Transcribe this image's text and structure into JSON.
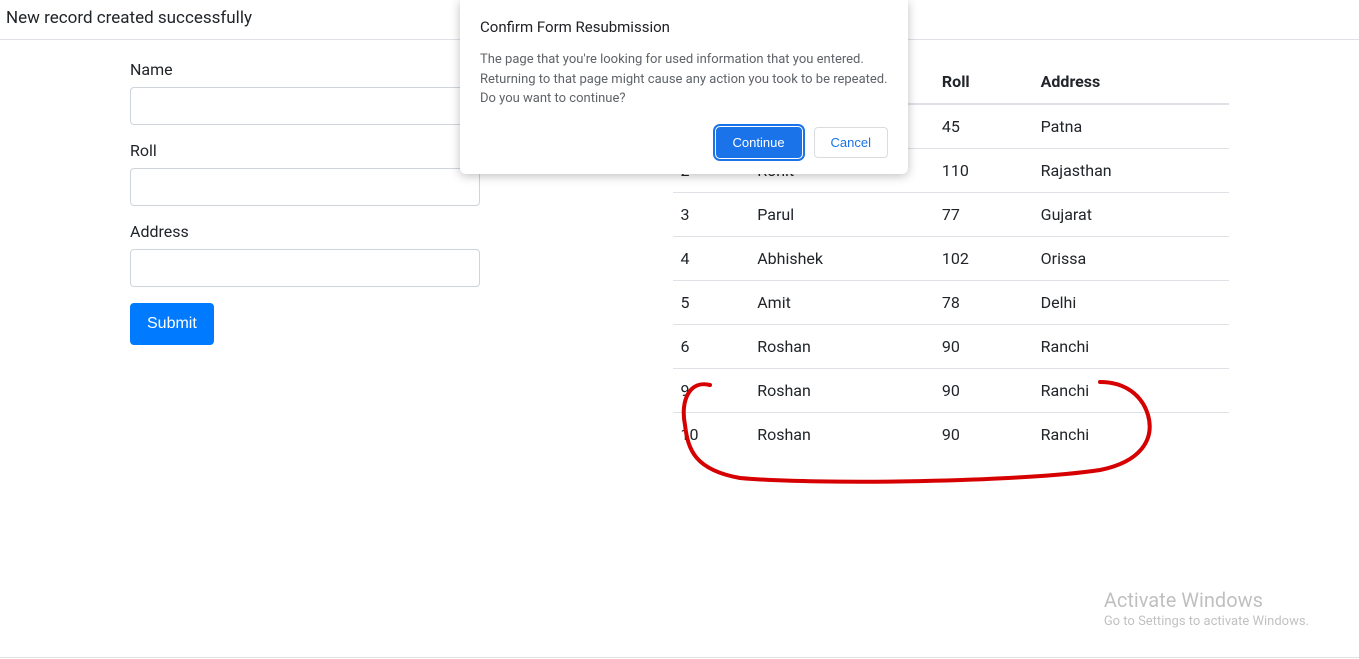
{
  "status_message": "New record created successfully",
  "form": {
    "name_label": "Name",
    "roll_label": "Roll",
    "address_label": "Address",
    "submit_label": "Submit"
  },
  "table": {
    "headers": {
      "roll": "Roll",
      "address": "Address"
    },
    "rows": [
      {
        "id": "",
        "name": "",
        "roll": "45",
        "address": "Patna"
      },
      {
        "id": "2",
        "name": "Rohit",
        "roll": "110",
        "address": "Rajasthan"
      },
      {
        "id": "3",
        "name": "Parul",
        "roll": "77",
        "address": "Gujarat"
      },
      {
        "id": "4",
        "name": "Abhishek",
        "roll": "102",
        "address": "Orissa"
      },
      {
        "id": "5",
        "name": "Amit",
        "roll": "78",
        "address": "Delhi"
      },
      {
        "id": "6",
        "name": "Roshan",
        "roll": "90",
        "address": "Ranchi"
      },
      {
        "id": "9",
        "name": "Roshan",
        "roll": "90",
        "address": "Ranchi"
      },
      {
        "id": "10",
        "name": "Roshan",
        "roll": "90",
        "address": "Ranchi"
      }
    ]
  },
  "dialog": {
    "title": "Confirm Form Resubmission",
    "body_line1": "The page that you're looking for used information that you entered.",
    "body_line2": "Returning to that page might cause any action you took to be repeated.",
    "body_line3": "Do you want to continue?",
    "continue_label": "Continue",
    "cancel_label": "Cancel"
  },
  "watermark": {
    "title": "Activate Windows",
    "sub": "Go to Settings to activate Windows."
  },
  "annotation": {
    "color": "#d60000"
  }
}
